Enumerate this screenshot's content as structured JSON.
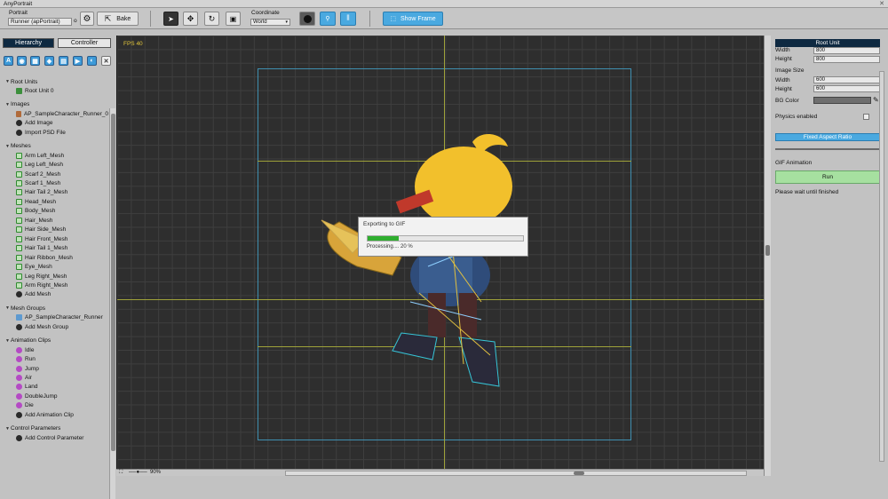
{
  "window": {
    "title": "AnyPortrait"
  },
  "toolbar": {
    "portrait_label": "Portrait",
    "portrait_value": "Runner (apPortrait)",
    "portrait_suffix": "o",
    "bake_label": "Bake",
    "coordinate_label": "Coordinate",
    "coordinate_value": "World",
    "show_frame_label": "Show Frame"
  },
  "left": {
    "tabs": [
      "Hierarchy",
      "Controller"
    ],
    "filter_icons": [
      "all-filter-icon",
      "root-filter-icon",
      "image-filter-icon",
      "mesh-filter-icon",
      "meshgroup-filter-icon",
      "clip-filter-icon",
      "param-filter-icon",
      "close-filter-icon"
    ],
    "sections": [
      {
        "title": "Root Units",
        "items": [
          "Root Unit 0"
        ]
      },
      {
        "title": "Images",
        "items": [
          "AP_SampleCharacter_Runner_0",
          "Add Image",
          "Import PSD File"
        ]
      },
      {
        "title": "Meshes",
        "items": [
          "Arm Left_Mesh",
          "Leg Left_Mesh",
          "Scarf 2_Mesh",
          "Scarf 1_Mesh",
          "Hair Tail 2_Mesh",
          "Head_Mesh",
          "Body_Mesh",
          "Hair_Mesh",
          "Hair Side_Mesh",
          "Hair Front_Mesh",
          "Hair Tail 1_Mesh",
          "Hair Ribbon_Mesh",
          "Eye_Mesh",
          "Leg Right_Mesh",
          "Arm Right_Mesh",
          "Add Mesh"
        ]
      },
      {
        "title": "Mesh Groups",
        "items": [
          "AP_SampleCharacter_Runner",
          "Add Mesh Group"
        ]
      },
      {
        "title": "Animation Clips",
        "items": [
          "Idle",
          "Run",
          "Jump",
          "Air",
          "Land",
          "DoubleJump",
          "Die",
          "Add Animation Clip"
        ]
      },
      {
        "title": "Control Parameters",
        "items": [
          "Add Control Parameter"
        ]
      }
    ]
  },
  "canvas": {
    "fps": "FPS 40",
    "zoom": "90%"
  },
  "dialog": {
    "title": "Exporting to GIF",
    "progress": 0.2,
    "progress_text": "Processing.... 20 %"
  },
  "right": {
    "header": "Root Unit",
    "width_label": "Width",
    "width_value": "800",
    "height_label": "Height",
    "height_value": "800",
    "image_size_label": "Image Size",
    "img_width_label": "Width",
    "img_width_value": "600",
    "img_height_label": "Height",
    "img_height_value": "600",
    "bg_color_label": "BG Color",
    "physics_label": "Physics enabled",
    "fixed_aspect_label": "Fixed Aspect Ratio",
    "gif_section_label": "GIF Animation",
    "run_label": "Run",
    "wait_text": "Please wait until finished"
  },
  "colors": {
    "accent": "#4aa9e0",
    "header_dark": "#0e2941",
    "progress": "#2fae2f",
    "run_button": "#a6e0a0"
  }
}
